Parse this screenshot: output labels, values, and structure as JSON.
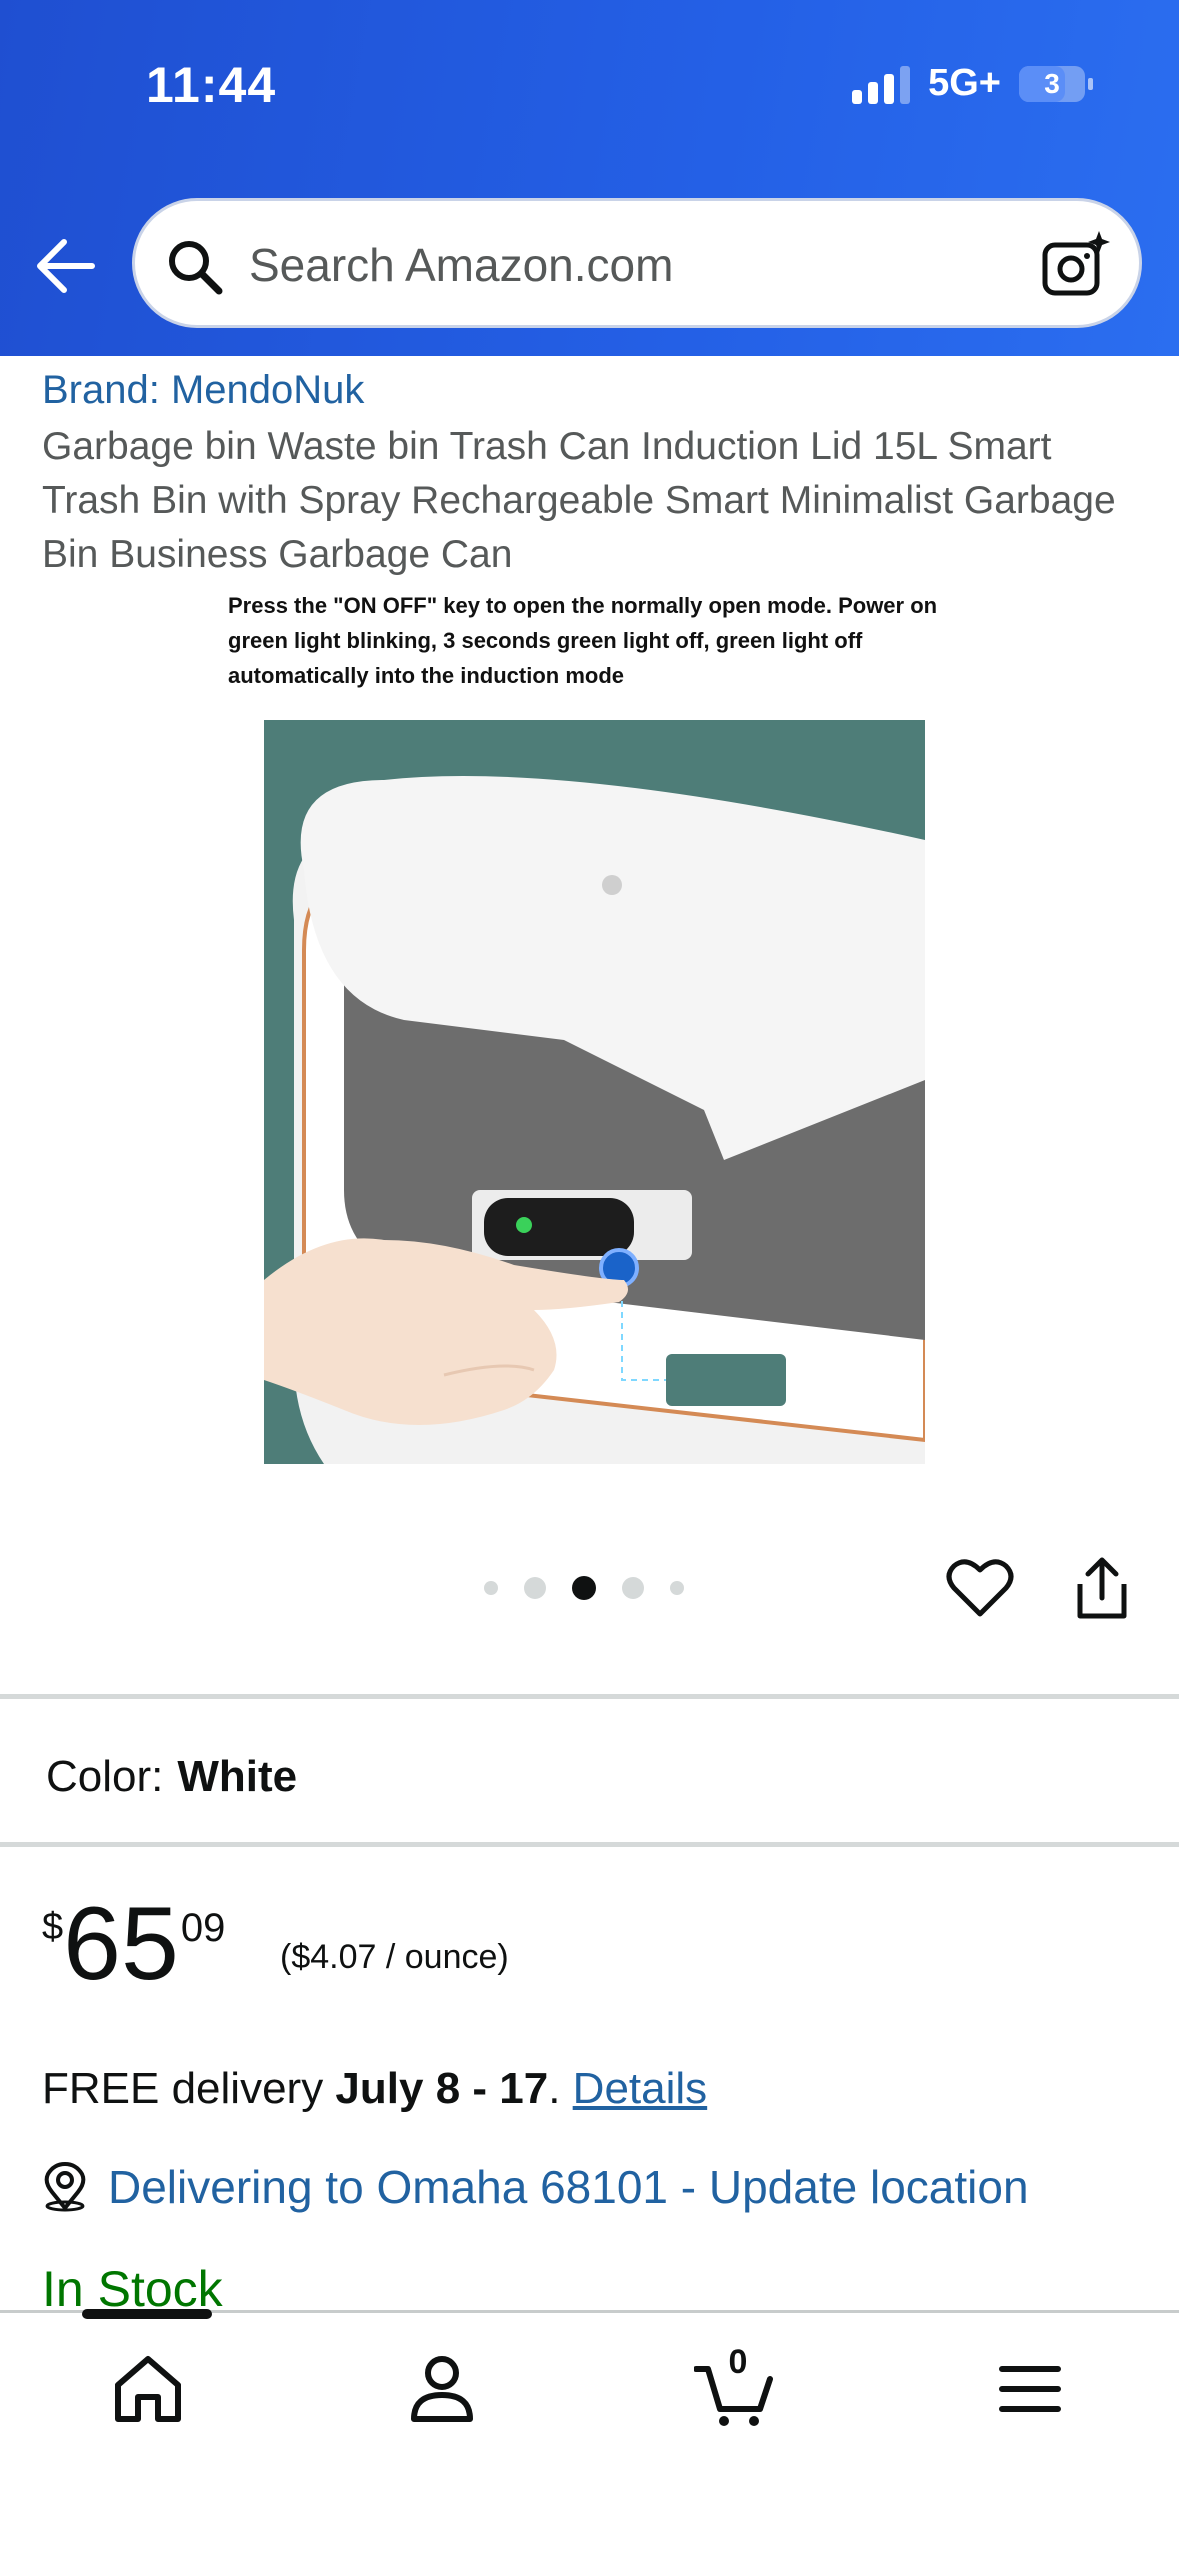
{
  "status_bar": {
    "time": "11:44",
    "network": "5G+",
    "battery": "3"
  },
  "search": {
    "placeholder": "Search Amazon.com"
  },
  "product": {
    "brand": "Brand: MendoNuk",
    "title": "Garbage bin Waste bin Trash Can Induction Lid 15L Smart Trash Bin with Spray Rechargeable Smart Minimalist Garbage Bin Business Garbage Can",
    "image_caption": "Press the \"ON OFF\" key to open the normally open mode. Power on green light blinking, 3 seconds green light off, green light off automatically into the induction mode",
    "image_dots_count": 5,
    "image_active_index": 2
  },
  "color": {
    "label": "Color:",
    "value": "White"
  },
  "price": {
    "symbol": "$",
    "whole": "65",
    "fraction": "09",
    "unit": "($4.07 / ounce)"
  },
  "delivery": {
    "prefix": "FREE delivery",
    "dates": "July 8 - 17",
    "separator": ".",
    "details_link": "Details"
  },
  "location": {
    "text": "Delivering to Omaha 68101 - Update location"
  },
  "stock": {
    "text": "In Stock"
  },
  "bottom_nav": {
    "cart_count": "0"
  },
  "colors": {
    "header_blue": "#2460e6",
    "link_blue": "#2162a1",
    "stock_green": "#007600"
  },
  "icons": [
    "back-arrow-icon",
    "search-icon",
    "camera-icon",
    "heart-icon",
    "share-icon",
    "location-icon",
    "home-icon",
    "account-icon",
    "cart-icon",
    "menu-icon"
  ]
}
